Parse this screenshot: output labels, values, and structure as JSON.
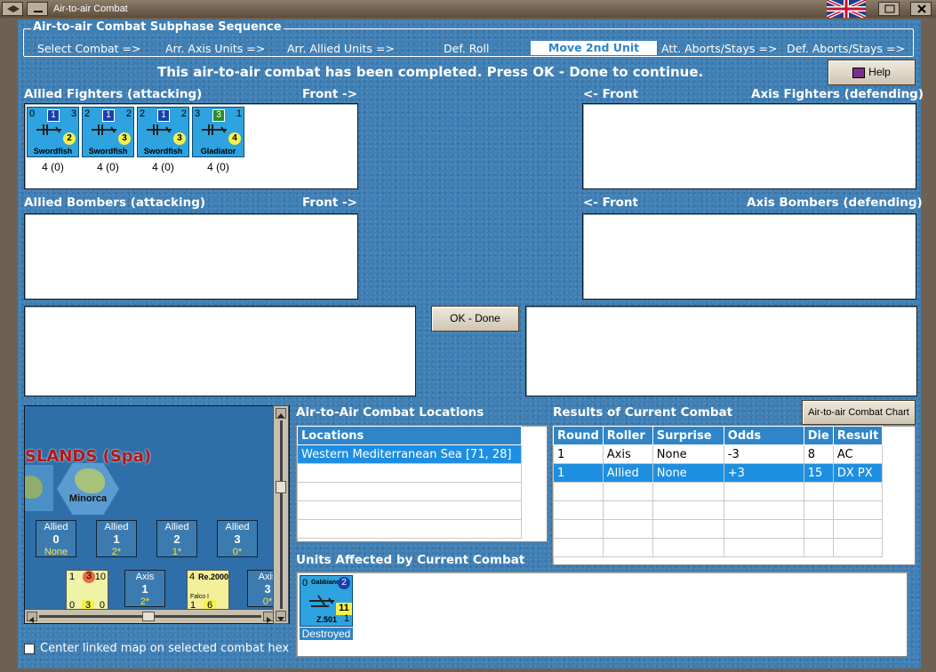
{
  "window": {
    "title": "Air-to-air Combat"
  },
  "sequence": {
    "title": "Air-to-air Combat Subphase Sequence",
    "steps": [
      "Select Combat =>",
      "Arr. Axis Units =>",
      "Arr. Allied Units =>",
      "Def. Roll",
      "Move 2nd Unit",
      "Att. Aborts/Stays =>",
      "Def. Aborts/Stays =>"
    ],
    "active": "Move 2nd Unit"
  },
  "status": "This air-to-air combat has been completed.  Press OK - Done to continue.",
  "help_label": "Help",
  "labels": {
    "allied_fighters": "Allied Fighters (attacking)",
    "front_right": "Front ->",
    "front_left": "<- Front",
    "axis_fighters": "Axis Fighters (defending)",
    "allied_bombers": "Allied Bombers (attacking)",
    "axis_bombers": "Axis Bombers (defending)",
    "locations_heading": "Air-to-Air Combat Locations",
    "results_heading": "Results of Current Combat",
    "affected_heading": "Units Affected by Current Combat"
  },
  "ok_label": "OK - Done",
  "chart_button": "Air-to-air Combat Chart",
  "allied_fighters": [
    {
      "left": "0",
      "center": "1",
      "right": "3",
      "name": "Swordfish",
      "circle": "2",
      "count": "4 (0)"
    },
    {
      "left": "2",
      "center": "1",
      "right": "2",
      "name": "Swordfish",
      "circle": "3",
      "count": "4 (0)"
    },
    {
      "left": "2",
      "center": "1",
      "right": "2",
      "name": "Swordfish",
      "circle": "3",
      "count": "4 (0)"
    },
    {
      "left": "3",
      "center": "3",
      "right": "1",
      "name": "Gladiator",
      "circle": "4",
      "count": "4 (0)"
    }
  ],
  "locations": {
    "header": "Locations",
    "rows": [
      "Western Mediterranean Sea [71, 28]"
    ]
  },
  "results": {
    "columns": [
      "Round",
      "Roller",
      "Surprise",
      "Odds",
      "Die",
      "Result"
    ],
    "rows": [
      [
        "1",
        "Axis",
        "None",
        "-3",
        "8",
        "AC"
      ],
      [
        "1",
        "Allied",
        "None",
        "+3",
        "15",
        "DX PX"
      ]
    ]
  },
  "affected": {
    "left": "0",
    "name": "Gabbiano",
    "circle": "2",
    "value": "11",
    "code": "Z.501",
    "bottom": "1",
    "status": "Destroyed"
  },
  "map": {
    "region": "SLANDS (Spa)",
    "island": "Minorca",
    "allied_cells": [
      {
        "t": "Allied",
        "n": "0",
        "v": "None"
      },
      {
        "t": "Allied",
        "n": "1",
        "v": "2*"
      },
      {
        "t": "Allied",
        "n": "2",
        "v": "1*"
      },
      {
        "t": "Allied",
        "n": "3",
        "v": "0*"
      }
    ],
    "axis_cells": [
      {
        "t": "Axis",
        "n": "1",
        "v": "2*"
      },
      {
        "t": "Axis",
        "n": "3",
        "v": "0*"
      }
    ],
    "counter1": {
      "tl": "1",
      "tm": "3",
      "tr": "10",
      "bl": "0",
      "bm": "3",
      "br": "0"
    },
    "counter2": {
      "tl": "4",
      "name": "Re.2000",
      "sub": "Falco I",
      "bl": "1",
      "bm": "6"
    }
  },
  "center_map": "Center linked map on selected combat hex",
  "colors": {
    "field": "#3f7fb4",
    "unit": "#2ea3df",
    "header": "#2f85c8",
    "selected": "#1e8fe0"
  }
}
